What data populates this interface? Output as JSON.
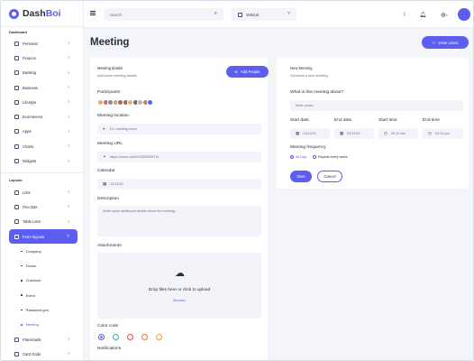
{
  "app": {
    "logo_prefix": "Dash",
    "logo_suffix": "Boi"
  },
  "sidebar": {
    "section_dashboard": "Dashboard",
    "items": [
      {
        "label": "Personal",
        "icon": "home-icon"
      },
      {
        "label": "Finance",
        "icon": "finance-icon"
      },
      {
        "label": "Banking",
        "icon": "bank-icon"
      },
      {
        "label": "Business",
        "icon": "briefcase-icon"
      },
      {
        "label": "Lifestyle",
        "icon": "lifestyle-icon"
      },
      {
        "label": "Ecommerce",
        "icon": "cart-icon"
      },
      {
        "label": "Apps",
        "icon": "apps-icon"
      },
      {
        "label": "Charts",
        "icon": "chart-icon"
      },
      {
        "label": "Widgets",
        "icon": "widgets-icon"
      }
    ],
    "section_layouts": "Layouts",
    "layout_items": [
      {
        "label": "Lists",
        "icon": "list-icon"
      },
      {
        "label": "Flex lists",
        "icon": "flex-list-icon"
      },
      {
        "label": "Table Lists",
        "icon": "table-icon"
      },
      {
        "label": "Form layouts",
        "icon": "form-icon"
      }
    ],
    "sub_items": [
      "Company",
      "Doctor",
      "Checkout",
      "Event",
      "Password gen",
      "Meeting"
    ],
    "bottom_items": [
      {
        "label": "Placeloads",
        "icon": "placeload-icon"
      },
      {
        "label": "Card Grids",
        "icon": "grid-icon"
      }
    ]
  },
  "topbar": {
    "search_placeholder": "Search",
    "layout_value": "Vertical"
  },
  "page": {
    "title": "Meeting",
    "invite_label": "Invite Users"
  },
  "left": {
    "details_title": "Meeting details",
    "details_sub": "Add some meeting details",
    "add_people_label": "Add People",
    "participants_label": "Participants",
    "location_label": "Meeting location",
    "location_placeholder": "Ex: meeting room",
    "url_label": "Meeting URL",
    "url_value": "https://zoom.us/hr/23639529714",
    "calendar_label": "Calendar",
    "calendar_value": "22/11/23",
    "description_label": "Description",
    "description_placeholder": "Write some additional details about the meeting...",
    "attachments_label": "Attachments",
    "drop_text": "Drop files here or click to upload",
    "browse_label": "Browse",
    "color_label": "Color code",
    "notifications_label": "Notifications",
    "colors": [
      "#5b5ef0",
      "#14b8a6",
      "#ef4444",
      "#f97316",
      "#f59e0b"
    ],
    "avatar_colors": [
      "#e8a87c",
      "#c46b6b",
      "#7f8c9b",
      "#d4a373",
      "#a56c4e",
      "#8d6e63",
      "#e0b089",
      "#6d6875",
      "#c9ada7",
      "#b08968",
      "#5b5ef0"
    ]
  },
  "right": {
    "new_title": "New Meeting",
    "new_sub": "Schedule a new meeting",
    "about_label": "What is this meeting about?",
    "about_placeholder": "Write yours...",
    "start_date_label": "Start date",
    "end_date_label": "End date",
    "start_time_label": "Start time",
    "end_time_label": "End time",
    "start_date": "12/11/23",
    "end_date": "22/11/23",
    "start_time": "09:10 am",
    "end_time": "03:10 pm",
    "frequency_label": "Meeting frequency",
    "freq_all_day": "All Day",
    "freq_repeat": "Repeat every week",
    "save_label": "Save",
    "cancel_label": "Cancel"
  }
}
